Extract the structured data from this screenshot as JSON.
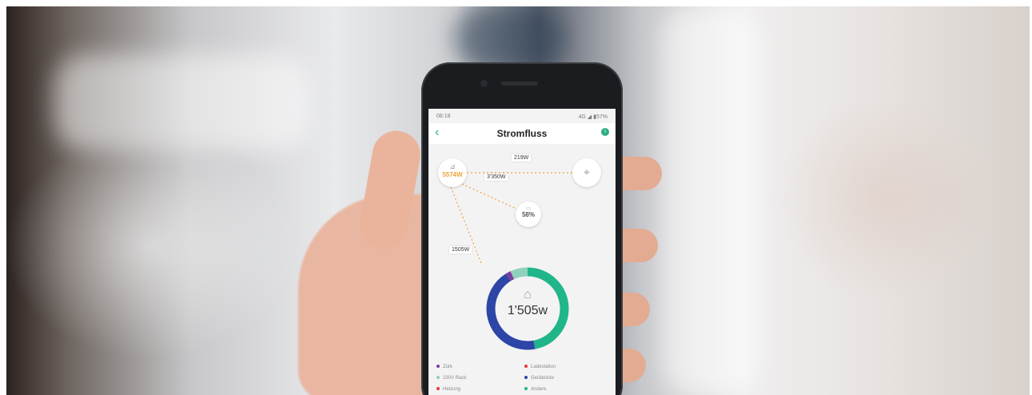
{
  "colors": {
    "accent": "#2fae84",
    "solar_orange": "#f2a23a",
    "donut_green": "#21b58a",
    "donut_blue": "#2c45a6",
    "donut_purple": "#7a3ea0",
    "donut_lightgreen": "#8fd1bd"
  },
  "status_bar": {
    "time": "08:18",
    "indicators": "4G ◢ ▮57%"
  },
  "nav": {
    "back_icon": "chevron-left-icon",
    "title": "Stromfluss",
    "info_icon": "info-icon"
  },
  "flow": {
    "solar_value": "5574W",
    "grid_flow_label": "219W",
    "battery_flow_label": "3'350W",
    "battery_percent": "58%",
    "house_flow_label": "1505W"
  },
  "consumption": {
    "total": "1'505w",
    "segments": [
      {
        "color": "#21b58a",
        "fraction": 0.47
      },
      {
        "color": "#2c45a6",
        "fraction": 0.44
      },
      {
        "color": "#7a3ea0",
        "fraction": 0.02
      },
      {
        "color": "#8fd1bd",
        "fraction": 0.07
      }
    ]
  },
  "legend": [
    {
      "label": "Zürk",
      "color": "#7a3ea0"
    },
    {
      "label": "Ladestation",
      "color": "#e23b3b"
    },
    {
      "label": "230V Rack",
      "color": "#8fd1bd"
    },
    {
      "label": "Geräteliste",
      "color": "#2c45a6"
    },
    {
      "label": "Heizung",
      "color": "#e23b3b"
    },
    {
      "label": "Andere",
      "color": "#21b58a"
    }
  ]
}
